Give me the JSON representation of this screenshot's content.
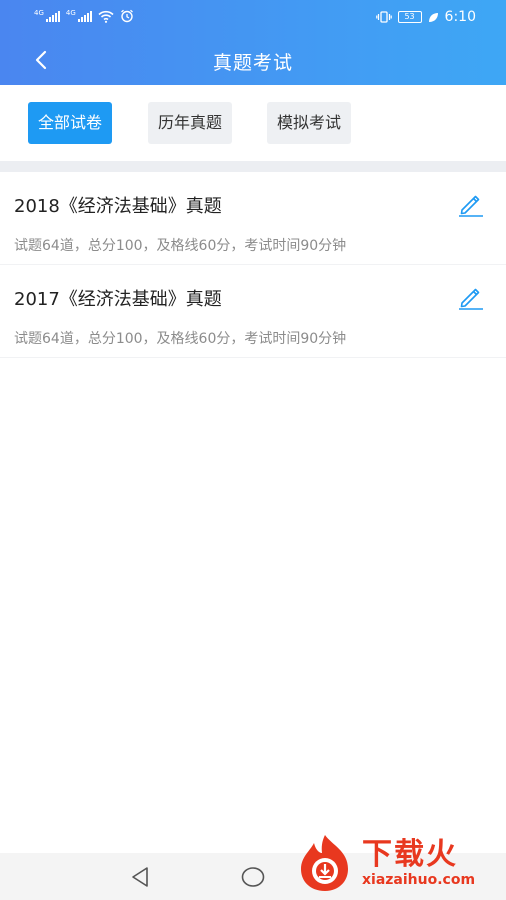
{
  "status_bar": {
    "sim1_tag": "4G",
    "sim2_tag": "4G",
    "battery": "53",
    "time": "6:10"
  },
  "navbar": {
    "title": "真题考试"
  },
  "tabs": [
    {
      "label": "全部试卷",
      "active": true
    },
    {
      "label": "历年真题",
      "active": false
    },
    {
      "label": "模拟考试",
      "active": false
    }
  ],
  "exams": [
    {
      "title": "2018《经济法基础》真题",
      "info": "试题64道，总分100，及格线60分，考试时间90分钟"
    },
    {
      "title": "2017《经济法基础》真题",
      "info": "试题64道，总分100，及格线60分，考试时间90分钟"
    }
  ],
  "watermark": {
    "text_cn": "下载火",
    "text_en": "xiazaihuo.com"
  },
  "colors": {
    "header_gradient_start": "#4a86f0",
    "header_gradient_end": "#3ea7f5",
    "active_tab": "#1e9af3",
    "edit_icon": "#1e9af3",
    "watermark": "#e8381f"
  }
}
